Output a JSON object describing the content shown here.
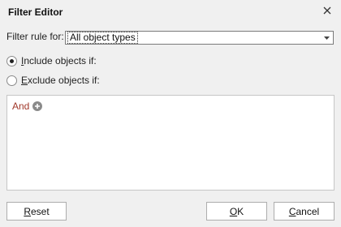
{
  "dialog": {
    "title": "Filter Editor"
  },
  "filter": {
    "label": "Filter rule for:",
    "selected": "All object types"
  },
  "options": {
    "include": {
      "accel": "I",
      "rest": "nclude objects if:",
      "selected": true
    },
    "exclude": {
      "accel": "E",
      "rest": "xclude objects if:",
      "selected": false
    }
  },
  "criteria": {
    "group_operator": "And"
  },
  "buttons": {
    "reset": {
      "accel": "R",
      "rest": "eset"
    },
    "ok": {
      "accel": "O",
      "rest": "K"
    },
    "cancel": {
      "accel": "C",
      "rest": "ancel"
    }
  },
  "colors": {
    "operator": "#a0382a",
    "add_icon": "#8a8a8a"
  },
  "icons": {
    "close": "close-icon",
    "dropdown": "chevron-down-icon",
    "add": "plus-circle-icon"
  }
}
